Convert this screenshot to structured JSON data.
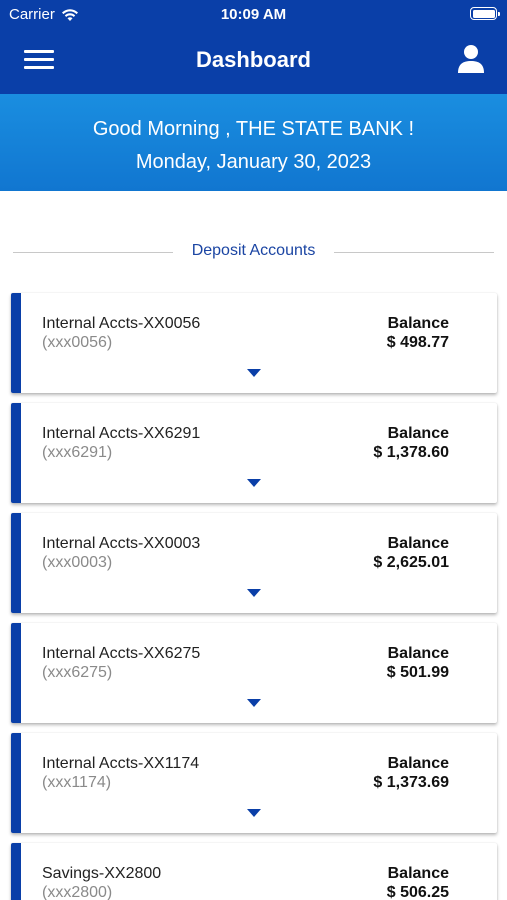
{
  "status_bar": {
    "carrier": "Carrier",
    "time": "10:09 AM"
  },
  "header": {
    "title": "Dashboard"
  },
  "greeting": {
    "line1": "Good Morning , THE STATE BANK !",
    "line2": "Monday, January 30, 2023"
  },
  "section": {
    "title": "Deposit Accounts"
  },
  "accounts": [
    {
      "name": "Internal Accts-XX0056",
      "masked": "(xxx0056)",
      "balance_label": "Balance",
      "balance": "$ 498.77"
    },
    {
      "name": "Internal Accts-XX6291",
      "masked": "(xxx6291)",
      "balance_label": "Balance",
      "balance": "$ 1,378.60"
    },
    {
      "name": "Internal Accts-XX0003",
      "masked": "(xxx0003)",
      "balance_label": "Balance",
      "balance": "$ 2,625.01"
    },
    {
      "name": "Internal Accts-XX6275",
      "masked": "(xxx6275)",
      "balance_label": "Balance",
      "balance": "$ 501.99"
    },
    {
      "name": "Internal Accts-XX1174",
      "masked": "(xxx1174)",
      "balance_label": "Balance",
      "balance": "$ 1,373.69"
    },
    {
      "name": "Savings-XX2800",
      "masked": "(xxx2800)",
      "balance_label": "Balance",
      "balance": "$ 506.25"
    }
  ],
  "icons": {
    "menu": "hamburger-menu-icon",
    "profile": "user-profile-icon",
    "expand": "caret-down-icon"
  },
  "colors": {
    "brand": "#0a3fa8",
    "banner": "#1a8ee0",
    "section_title": "#1b45a3"
  }
}
